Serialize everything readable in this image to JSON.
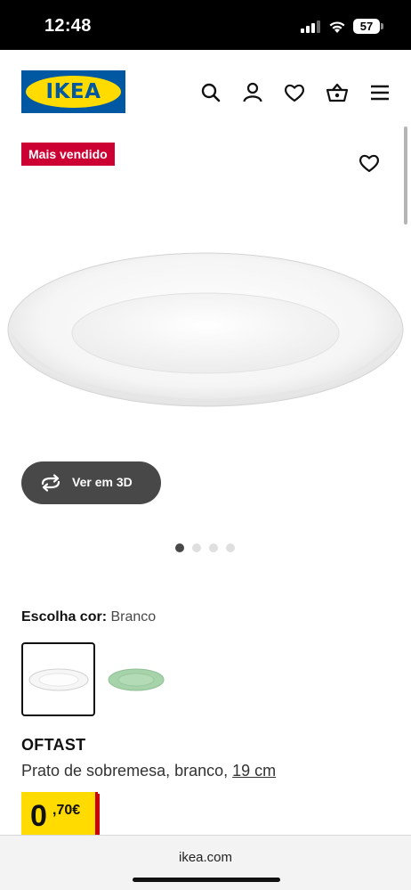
{
  "status_bar": {
    "time": "12:48",
    "battery_level": "57"
  },
  "header": {
    "logo_text": "IKEA",
    "icons": [
      "search-icon",
      "user-icon",
      "heart-icon",
      "basket-icon",
      "menu-icon"
    ]
  },
  "product": {
    "badge": "Mais vendido",
    "view_3d_label": "Ver em 3D",
    "gallery_dot_count": 4,
    "gallery_active_index": 0,
    "color_label": "Escolha cor:",
    "color_value": "Branco",
    "swatches": [
      {
        "name": "white",
        "color": "#f4f4f4",
        "selected": true
      },
      {
        "name": "green",
        "color": "#a6d3aa",
        "selected": false
      }
    ],
    "name": "OFTAST",
    "description": "Prato de sobremesa, branco,",
    "size": "19 cm",
    "price_integer": "0",
    "price_decimal": ",70€"
  },
  "browser": {
    "url": "ikea.com"
  },
  "colors": {
    "ikea_blue": "#0058a3",
    "ikea_yellow": "#ffdb00",
    "badge_red": "#cc0033",
    "button_dark": "#484848"
  }
}
